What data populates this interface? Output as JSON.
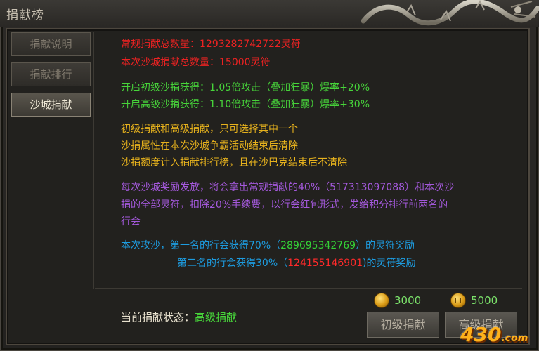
{
  "window": {
    "title": "捐献榜"
  },
  "tabs": [
    {
      "label": "捐献说明",
      "active": false
    },
    {
      "label": "捐献排行",
      "active": false
    },
    {
      "label": "沙城捐献",
      "active": true
    }
  ],
  "content": {
    "normal_total": "常规捐献总数量：1293282742722灵符",
    "this_total": "本次沙城捐献总数量：15000灵符",
    "primary_bonus": "开启初级沙捐获得：1.05倍攻击（叠加狂暴）爆率+20%",
    "advanced_bonus": "开启高级沙捐获得：1.10倍攻击（叠加狂暴）爆率+30%",
    "rule1": "初级捐献和高级捐献，只可选择其中一个",
    "rule2": "沙捐属性在本次沙城争霸活动结束后清除",
    "rule3": "沙捐额度计入捐献排行榜，且在沙巴克结束后不清除",
    "reward_line1": "每次沙城奖励发放，将会拿出常规捐献的40%（517313097088）和本次沙",
    "reward_line2": "捐的全部灵符，扣除20%手续费，以行会红包形式，发给积分排行前两名的",
    "reward_line3": "行会",
    "first_prefix": "本次攻沙，第一名的行会获得70%（",
    "first_amount": "289695342769",
    "first_suffix": "）的灵符奖励",
    "second_prefix": "第二名的行会获得30%（",
    "second_amount": "124155146901",
    "second_suffix": ")的灵符奖励"
  },
  "footer": {
    "status_label": "当前捐献状态：",
    "status_value": "高级捐献",
    "primary_cost": "3000",
    "advanced_cost": "5000",
    "primary_button": "初级捐献",
    "advanced_button": "高级捐献"
  },
  "watermark": {
    "text": "430",
    "suffix": ".com"
  },
  "colors": {
    "red": "#ec2222",
    "green": "#47d43a",
    "yellow": "#e7b21d",
    "purple": "#a459dc",
    "blue": "#1d9ce0"
  }
}
